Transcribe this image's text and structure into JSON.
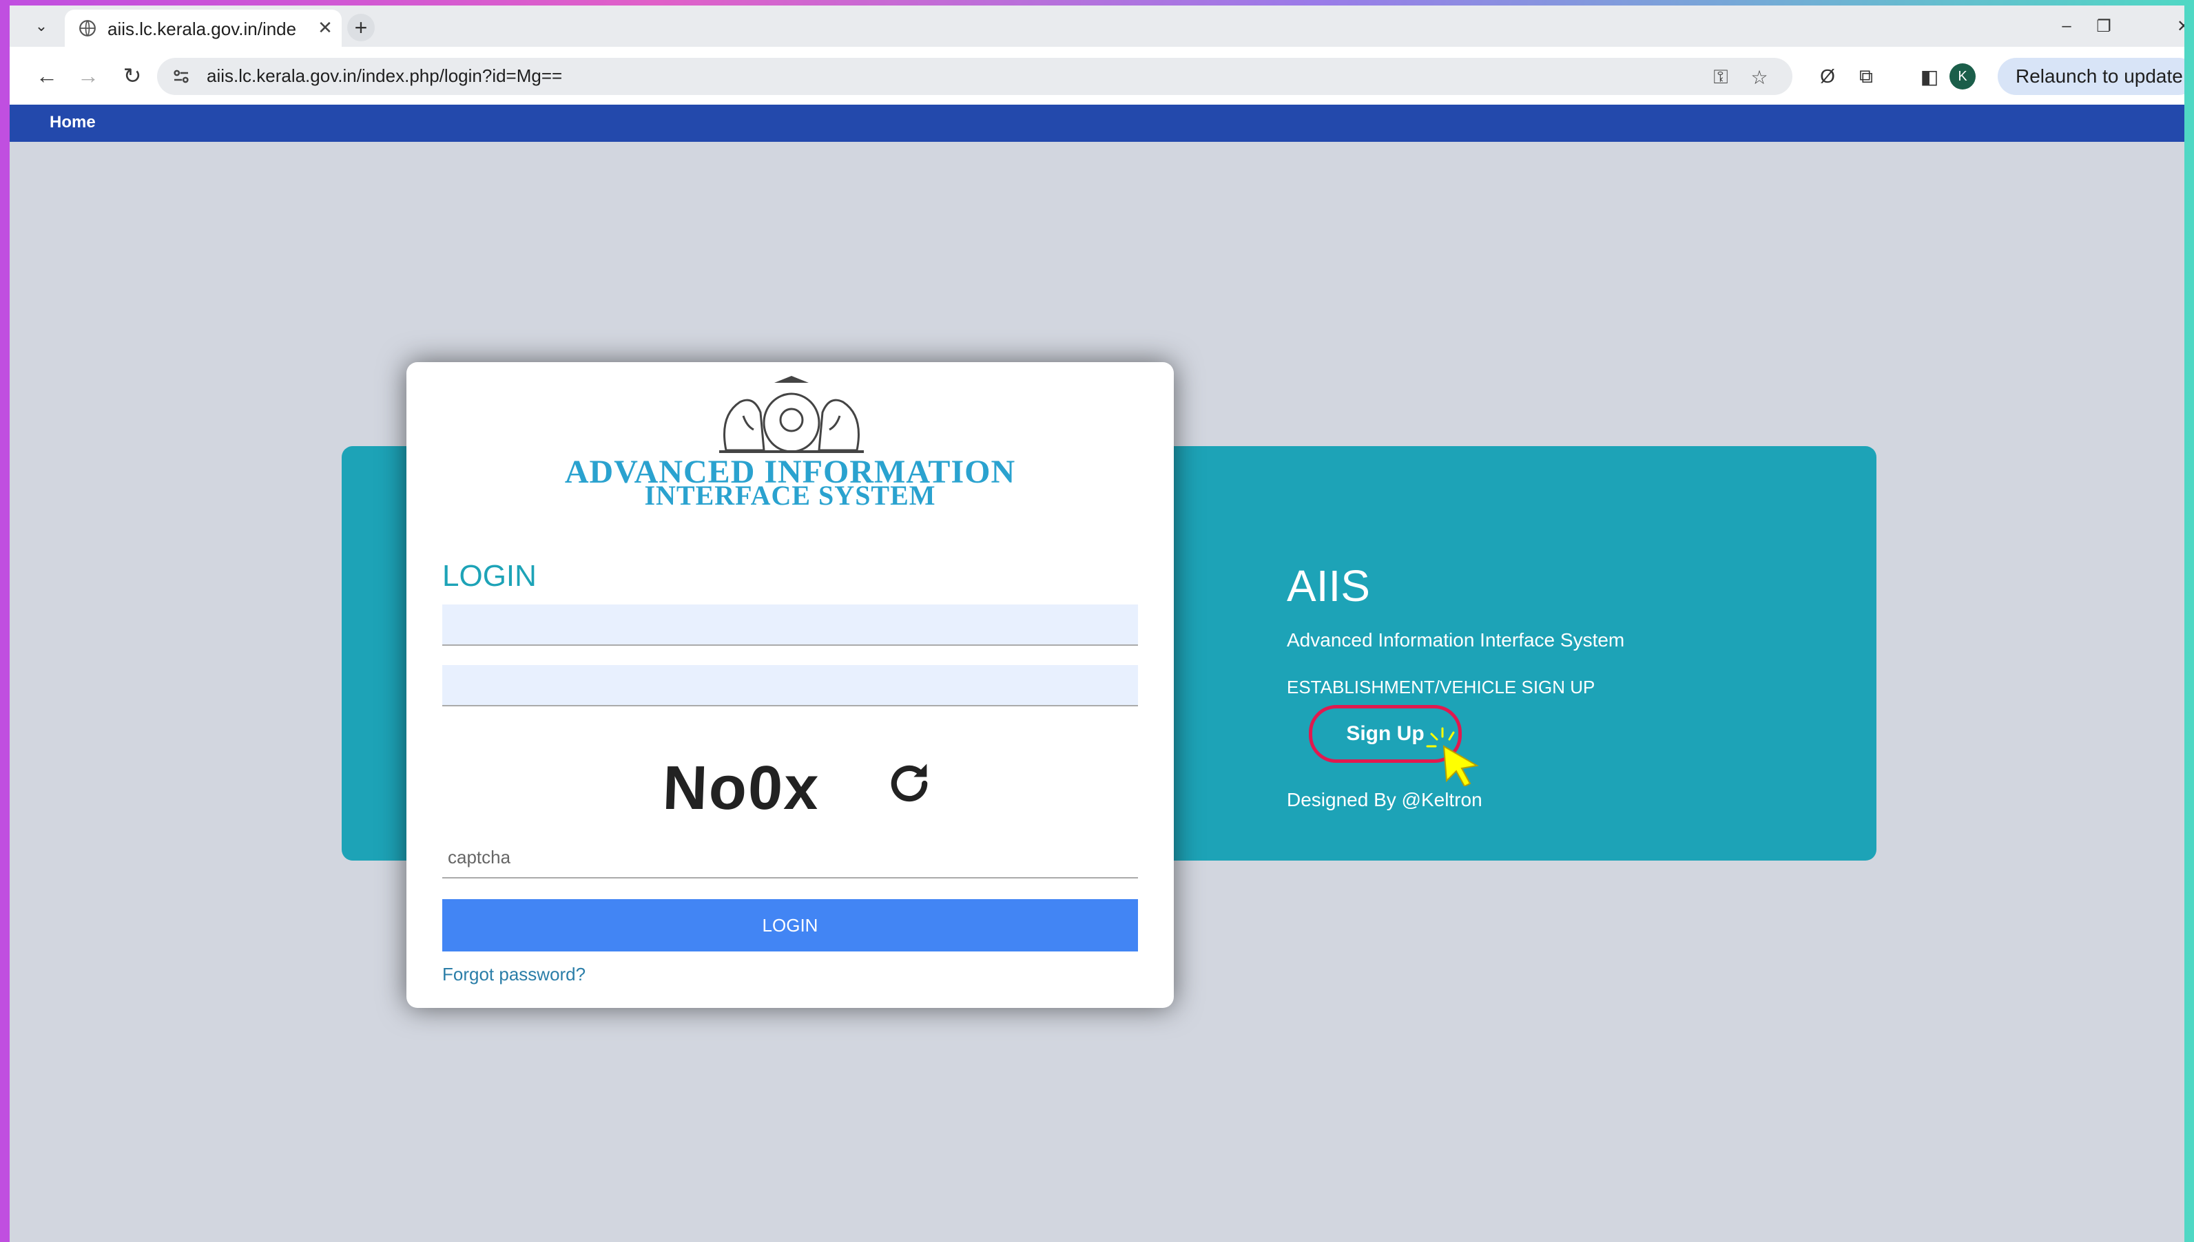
{
  "browser": {
    "tab_title": "aiis.lc.kerala.gov.in/inde",
    "url": "aiis.lc.kerala.gov.in/index.php/login?id=Mg==",
    "avatar_letter": "K",
    "relaunch_label": "Relaunch to update"
  },
  "nav": {
    "home": "Home"
  },
  "login_card": {
    "brand_line1": "ADVANCED INFORMATION",
    "brand_line2": "INTERFACE SYSTEM",
    "heading": "LOGIN",
    "username_value": "",
    "password_value": "",
    "captcha_text": "No0x",
    "captcha_placeholder": "captcha",
    "login_button": "LOGIN",
    "forgot_link": "Forgot password?"
  },
  "info_panel": {
    "title": "AIIS",
    "subtitle": "Advanced Information Interface System",
    "signup_caption": "ESTABLISHMENT/VEHICLE SIGN UP",
    "signup_button": "Sign Up",
    "designed_by": "Designed By @Keltron"
  },
  "colors": {
    "nav_bar": "#2349ac",
    "panel": "#1da3b7",
    "login_button": "#4285f4",
    "highlight": "#e0194f",
    "cursor": "#ffff00"
  }
}
